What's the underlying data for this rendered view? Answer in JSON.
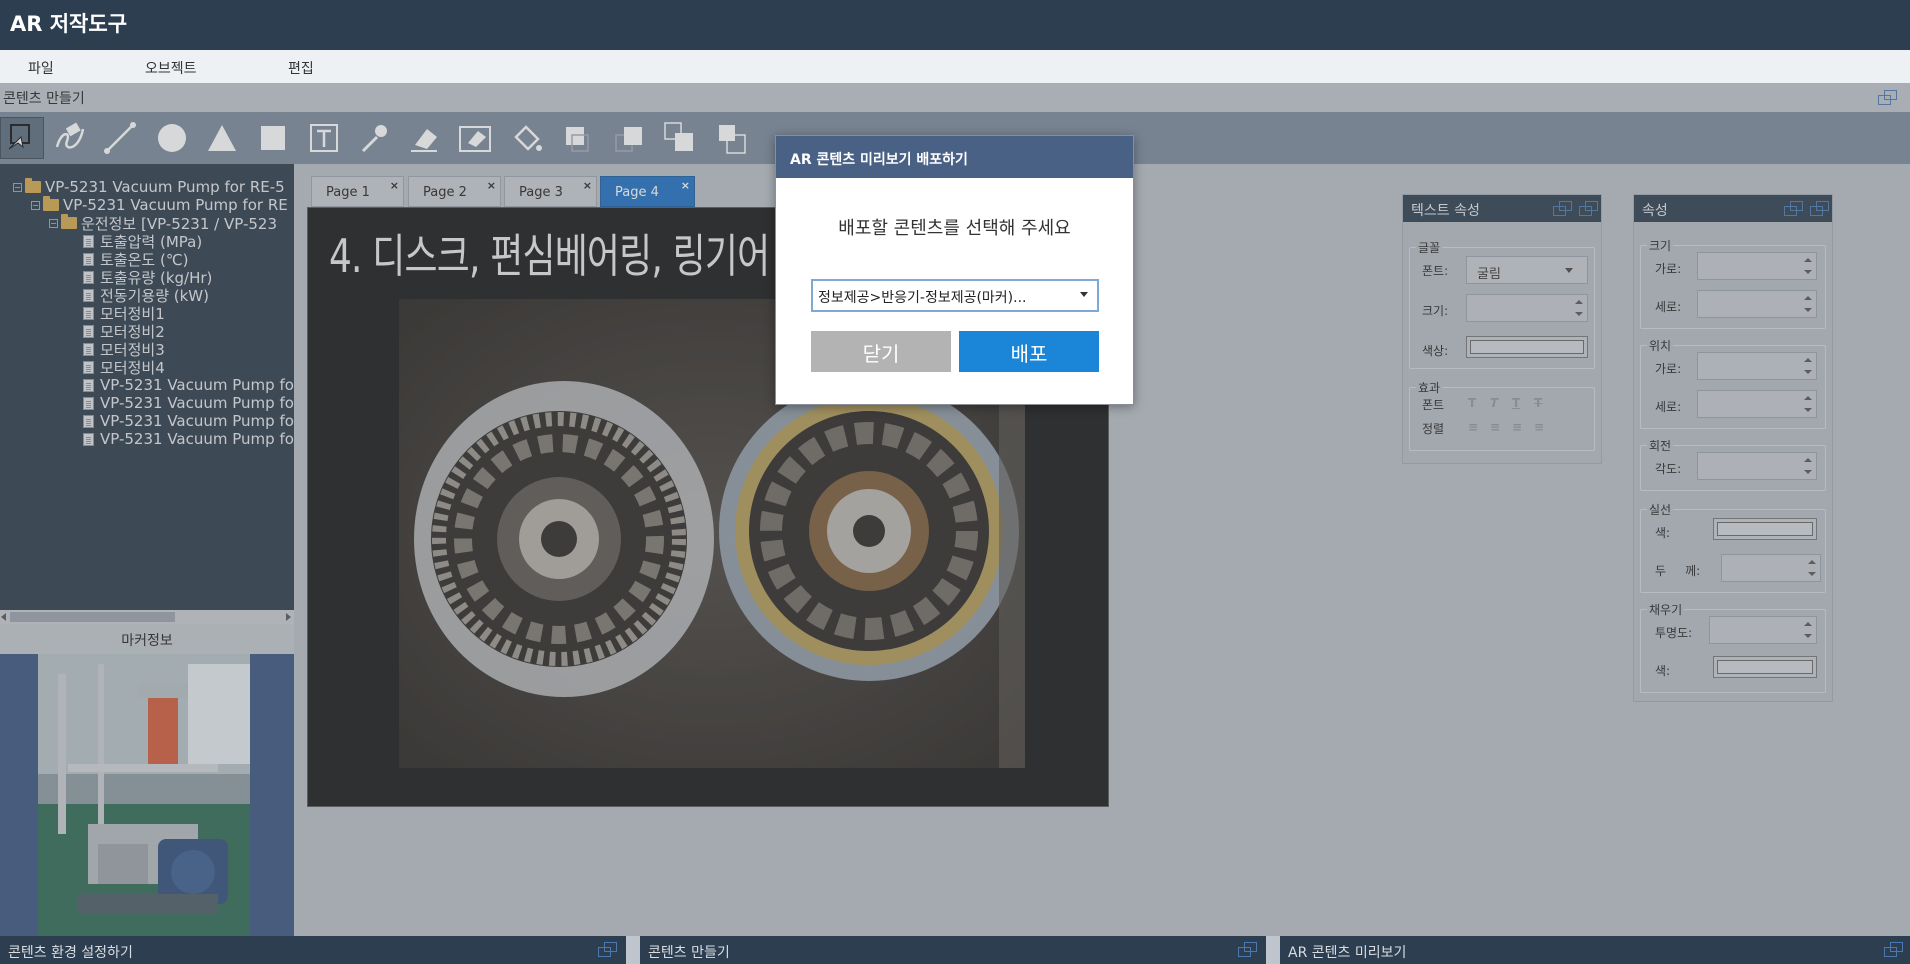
{
  "app": {
    "title": "AR 저작도구"
  },
  "menu": {
    "file": "파일",
    "object": "오브젝트",
    "edit": "편집"
  },
  "content_panel": {
    "title": "콘텐츠 만들기"
  },
  "toolbar": {
    "tools": [
      "select-tool",
      "curve-tool",
      "line-tool",
      "circle-tool",
      "triangle-tool",
      "rectangle-tool",
      "text-tool",
      "eyedropper-tool",
      "eraser-tool",
      "clear-tool",
      "fill-tool",
      "bring-front-tool",
      "send-back-tool",
      "bring-forward-tool",
      "send-backward-tool"
    ]
  },
  "tree": {
    "items": [
      "VP-5231 Vacuum Pump for RE-5",
      "VP-5231 Vacuum Pump for RE",
      "운전정보 [VP-5231 / VP-523",
      "토출압력 (MPa)",
      "토출온도 (℃)",
      "토출유량 (kg/Hr)",
      "전동기용량 (kW)",
      "모터정비1",
      "모터정비2",
      "모터정비3",
      "모터정비4",
      "VP-5231 Vacuum Pump fo",
      "VP-5231 Vacuum Pump fo",
      "VP-5231 Vacuum Pump fo",
      "VP-5231 Vacuum Pump fo"
    ]
  },
  "marker": {
    "title": "마커정보"
  },
  "pages": {
    "tabs": [
      "Page 1",
      "Page 2",
      "Page 3",
      "Page 4"
    ],
    "active": "Page 4",
    "close": "×"
  },
  "slide": {
    "title": "4. 디스크, 편심베어링, 링기어"
  },
  "text_props": {
    "title": "텍스트 속성",
    "font_group": "글꼴",
    "font_label": "폰트:",
    "font_value": "굴림",
    "size_label": "크기:",
    "color_label": "색상:",
    "effect_group": "효과",
    "effect_font_label": "폰트",
    "effect_align_label": "정렬",
    "font_fx": [
      "T",
      "T",
      "T",
      "T"
    ],
    "align_fx": [
      "≡",
      "≡",
      "≡",
      "≡"
    ]
  },
  "props": {
    "title": "속성",
    "size_group": "크기",
    "width_label": "가로:",
    "height_label": "세로:",
    "position_group": "위치",
    "pos_x_label": "가로:",
    "pos_y_label": "세로:",
    "rotation_group": "회전",
    "angle_label": "각도:",
    "line_group": "실선",
    "line_color_label": "색:",
    "line_width_label": "두     께:",
    "fill_group": "채우기",
    "opacity_label": "투명도:",
    "fill_color_label": "색:"
  },
  "dialog": {
    "title": "AR 콘텐츠 미리보기 배포하기",
    "message": "배포할 콘텐츠를 선택해 주세요",
    "selected": "정보제공>반응기-정보제공(마커)...",
    "close_label": "닫기",
    "deploy_label": "배포"
  },
  "bottom": {
    "env": "콘텐츠 환경 설정하기",
    "create": "콘텐츠 만들기",
    "preview": "AR 콘텐츠 미리보기"
  },
  "colors": {
    "titlebar": "#2c3e50",
    "dialog_header": "#4a6186",
    "deploy_button": "#1b86d8",
    "active_tab": "#1e6fc4"
  }
}
